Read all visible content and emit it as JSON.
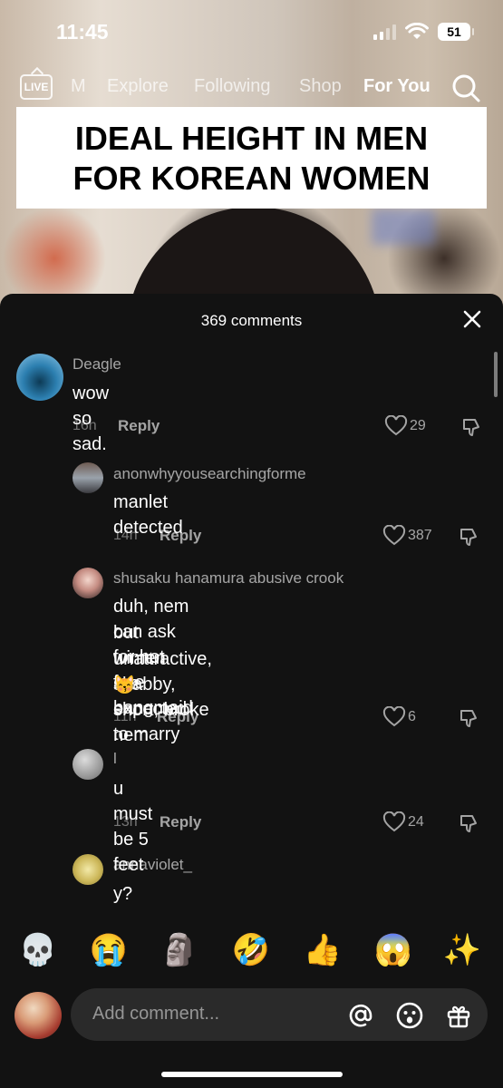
{
  "status_bar": {
    "time": "11:45",
    "battery": "51"
  },
  "top_nav": {
    "live_label": "LIVE",
    "tabs": [
      {
        "label": "M"
      },
      {
        "label": "Explore"
      },
      {
        "label": "Following"
      },
      {
        "label": "Shop"
      },
      {
        "label": "For You"
      }
    ]
  },
  "video": {
    "caption_line1": "IDEAL HEIGHT IN MEN",
    "caption_line2": "FOR KOREAN WOMEN"
  },
  "comments_panel": {
    "count_label": "369 comments",
    "comments": [
      {
        "user": "Deagle",
        "text": "wow so sad.",
        "time": "16h",
        "reply": "Reply",
        "likes": "29"
      },
      {
        "user": "anonwhyyousearchingforme",
        "text": "manlet detected",
        "time": "14h",
        "reply": "Reply",
        "likes": "387"
      },
      {
        "user": "shusaku hanamura abusive crook",
        "text_lines": [
          "duh, nem can ask for hot free bangmaid",
          "but wimen are expected to marry",
          "unattractive, shabby, short, broke nem",
          "😽"
        ],
        "time": "11h",
        "reply": "Reply",
        "likes": "6"
      },
      {
        "user": "l",
        "text": "u must be 5 feet",
        "time": "13h",
        "reply": "Reply",
        "likes": "24"
      },
      {
        "user": "annaviolet_",
        "text": "y?"
      }
    ]
  },
  "emoji_bar": [
    "💀",
    "😭",
    "🗿",
    "🤣",
    "👍",
    "😱",
    "✨"
  ],
  "composer": {
    "placeholder": "Add comment..."
  },
  "colors": {
    "sheet_bg": "#121212",
    "input_bg": "#2a2a2a"
  }
}
